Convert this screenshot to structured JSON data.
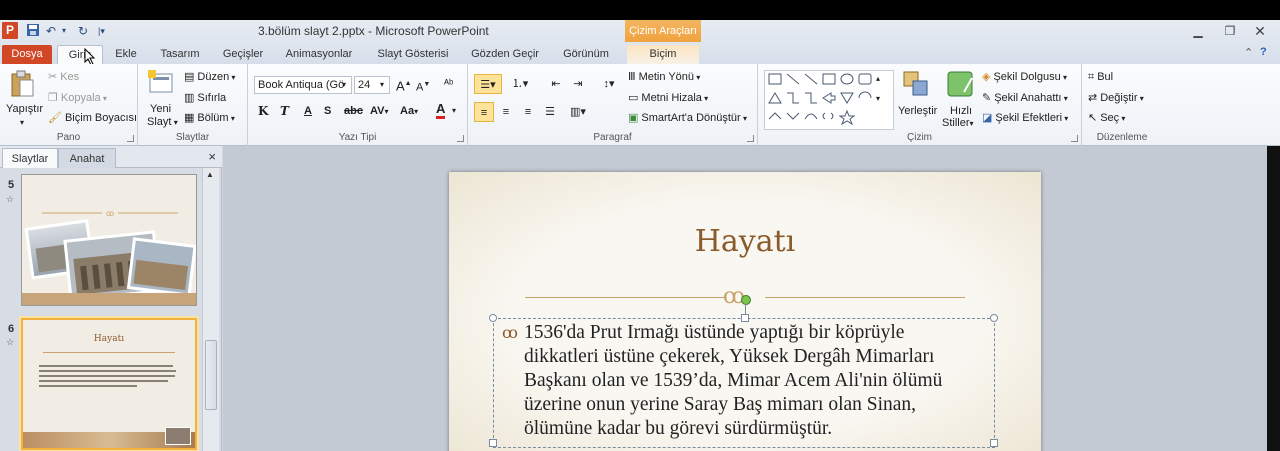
{
  "title_bar": {
    "app_icon": "P",
    "title": "3.bölüm slayt 2.pptx  -  Microsoft PowerPoint",
    "context_header": "Çizim Araçları",
    "icons": [
      "save-icon",
      "undo-icon",
      "redo-icon",
      "customize-qat-icon",
      "minimize-icon",
      "restore-icon",
      "close-icon"
    ]
  },
  "tabs": {
    "file": "Dosya",
    "home": "Giriş",
    "insert": "Ekle",
    "design": "Tasarım",
    "transitions": "Geçişler",
    "animations": "Animasyonlar",
    "slideshow": "Slayt Gösterisi",
    "review": "Gözden Geçir",
    "view": "Görünüm",
    "format": "Biçim"
  },
  "ribbon": {
    "clipboard": {
      "label": "Pano",
      "paste": "Yapıştır",
      "cut": "Kes",
      "copy": "Kopyala",
      "format_painter": "Biçim Boyacısı"
    },
    "slides": {
      "label": "Slaytlar",
      "new_slide_1": "Yeni",
      "new_slide_2": "Slayt",
      "layout": "Düzen",
      "reset": "Sıfırla",
      "section": "Bölüm"
    },
    "font": {
      "label": "Yazı Tipi",
      "font_name": "Book Antiqua (Gö",
      "font_size": "24",
      "bold": "K",
      "italic": "T",
      "underline": "A",
      "shadow": "S",
      "strike": "abc",
      "spacing": "AV",
      "case": "Aa",
      "color": "A"
    },
    "paragraph": {
      "label": "Paragraf",
      "text_direction": "Metin Yönü",
      "align_text": "Metni Hizala",
      "smartart": "SmartArt'a Dönüştür"
    },
    "drawing": {
      "label": "Çizim",
      "arrange": "Yerleştir",
      "quick_styles_1": "Hızlı",
      "quick_styles_2": "Stiller",
      "shape_fill": "Şekil Dolgusu",
      "shape_outline": "Şekil Anahattı",
      "shape_effects": "Şekil Efektleri"
    },
    "editing": {
      "label": "Düzenleme",
      "find": "Bul",
      "replace": "Değiştir",
      "select": "Seç"
    }
  },
  "left_pane": {
    "tab_slides": "Slaytlar",
    "tab_outline": "Anahat",
    "close": "×",
    "slides": [
      {
        "number": "5"
      },
      {
        "number": "6",
        "title": "Hayatı"
      }
    ]
  },
  "slide": {
    "title": "Hayatı",
    "body_lines": [
      "1536'da Prut Irmağı üstünde yaptığı bir köprüyle",
      "dikkatleri üstüne çekerek, Yüksek Dergâh Mimarları",
      "Başkanı olan ve 1539’da, Mimar Acem Ali'nin ölümü",
      "üzerine onun yerine Saray Baş mimarı olan Sinan,",
      "ölümüne kadar bu görevi sürdürmüştür."
    ]
  },
  "colors": {
    "file_tab": "#d24726",
    "context_tab": "#f0a23e",
    "slide_title": "#8a5a2b",
    "selection": "#f2b33d"
  }
}
